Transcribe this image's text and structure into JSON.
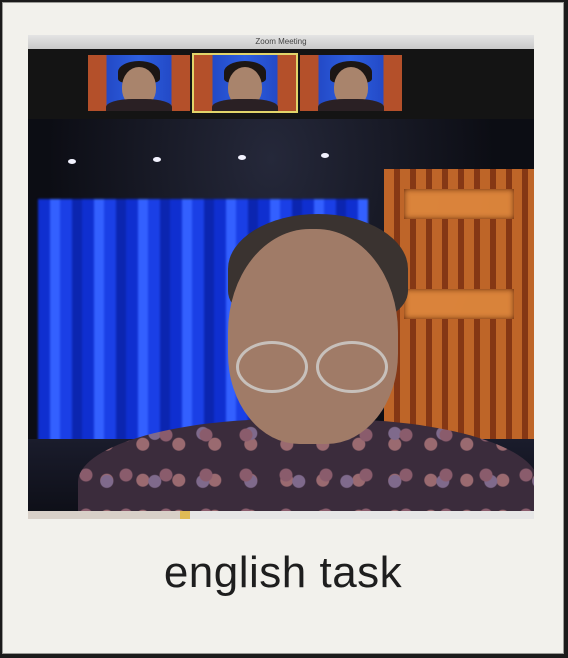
{
  "window": {
    "title": "Zoom Meeting"
  },
  "participants": [
    {
      "position": "left",
      "active": false
    },
    {
      "position": "center",
      "active": true
    },
    {
      "position": "right",
      "active": false
    }
  ],
  "caption": "english task",
  "colors": {
    "frame": "#f2f1ec",
    "curtain": "#1f47f0",
    "active_border": "#e2d56a"
  }
}
